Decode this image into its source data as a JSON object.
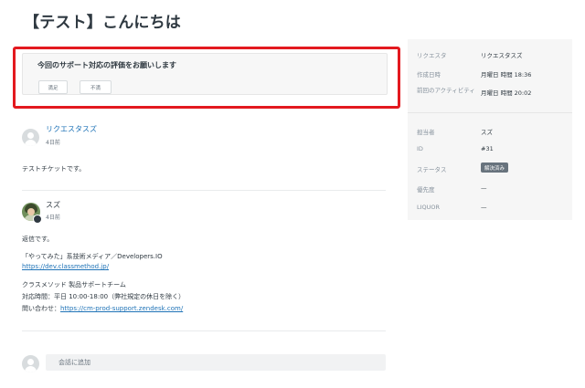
{
  "page": {
    "title": "【テスト】こんにちは"
  },
  "survey": {
    "question": "今回のサポート対応の評価をお願いします",
    "good_label": "満足",
    "bad_label": "不満"
  },
  "comments": [
    {
      "author": "リクエスタスズ",
      "time": "4日前",
      "lines": [
        "テストチケットです。"
      ]
    },
    {
      "author": "スズ",
      "time": "4日前",
      "lines": [
        "返信です。",
        "「やってみた」系技術メディア／Developers.IO",
        "https://dev.classmethod.jp/",
        "クラスメソッド 製品サポートチーム",
        "対応時間：平日 10:00-18:00（弊社規定の休日を除く）",
        "問い合わせ："
      ],
      "support_link": "https://cm-prod-support.zendesk.com/"
    }
  ],
  "reply": {
    "placeholder": "会話に追加"
  },
  "properties": {
    "requester_label": "リクエスタ",
    "requester_value": "リクエスタスズ",
    "created_label": "作成日時",
    "created_value": "月曜日 時間 18:36",
    "last_activity_label": "前回のアクティビティ",
    "last_activity_value": "月曜日 時間 20:02",
    "assignee_label": "担当者",
    "assignee_value": "スズ",
    "id_label": "ID",
    "id_value": "#31",
    "status_label": "ステータス",
    "status_value": "解決済み",
    "priority_label": "優先度",
    "priority_value": "—",
    "liquor_label": "LIQUOR",
    "liquor_value": "—"
  },
  "colors": {
    "highlight": "#e3191f",
    "link": "#1f73b7",
    "status_badge": "#68737d"
  }
}
